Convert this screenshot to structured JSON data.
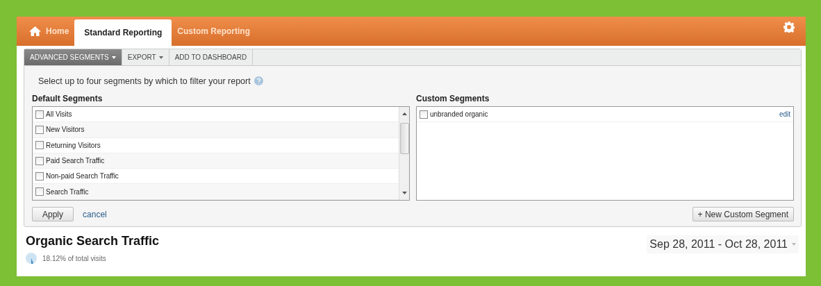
{
  "nav": {
    "tabs": [
      {
        "label": "Home",
        "kind": "home",
        "selected": false
      },
      {
        "label": "Standard Reporting",
        "kind": "plain",
        "selected": true
      },
      {
        "label": "Custom Reporting",
        "kind": "plain",
        "selected": false
      }
    ]
  },
  "toolbar": [
    {
      "label": "ADVANCED SEGMENTS",
      "dropdown": true,
      "selected": true
    },
    {
      "label": "EXPORT",
      "dropdown": true,
      "selected": false
    },
    {
      "label": "ADD TO DASHBOARD",
      "dropdown": false,
      "selected": false
    }
  ],
  "intro": "Select up to four segments by which to filter your report",
  "default_segments": {
    "title": "Default Segments",
    "items": [
      {
        "label": "All Visits",
        "checked": false
      },
      {
        "label": "New Visitors",
        "checked": false
      },
      {
        "label": "Returning Visitors",
        "checked": false
      },
      {
        "label": "Paid Search Traffic",
        "checked": false
      },
      {
        "label": "Non-paid Search Traffic",
        "checked": false
      },
      {
        "label": "Search Traffic",
        "checked": false
      }
    ]
  },
  "custom_segments": {
    "title": "Custom Segments",
    "items": [
      {
        "label": "unbranded organic",
        "checked": false,
        "action": "edit"
      }
    ]
  },
  "apply_button": "Apply",
  "cancel_link": "cancel",
  "new_segment_button": "+ New Custom Segment",
  "report": {
    "title": "Organic Search Traffic",
    "share": "18.12% of total visits",
    "date_range": "Sep 28, 2011 - Oct 28, 2011"
  }
}
